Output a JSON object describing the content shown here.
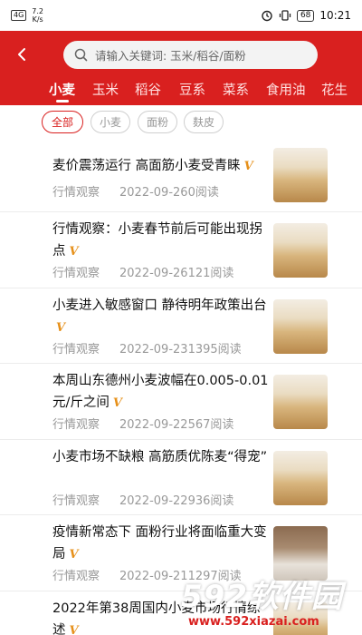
{
  "status_bar": {
    "signal": "4G",
    "speed": "7.2",
    "speed_unit": "K/s",
    "battery": "68",
    "time": "10:21"
  },
  "header": {
    "search_placeholder": "请输入关键词: 玉米/稻谷/面粉",
    "tabs": [
      {
        "label": "小麦",
        "active": true
      },
      {
        "label": "玉米",
        "active": false
      },
      {
        "label": "稻谷",
        "active": false
      },
      {
        "label": "豆系",
        "active": false
      },
      {
        "label": "菜系",
        "active": false
      },
      {
        "label": "食用油",
        "active": false
      },
      {
        "label": "花生",
        "active": false
      }
    ],
    "accent_color": "#d9201f"
  },
  "filters": [
    {
      "label": "全部",
      "active": true
    },
    {
      "label": "小麦",
      "active": false
    },
    {
      "label": "面粉",
      "active": false
    },
    {
      "label": "麸皮",
      "active": false
    }
  ],
  "articles": [
    {
      "title": "麦价震荡运行 高面筋小麦受青睐",
      "v": "V",
      "source": "行情观察",
      "date": "2022-09-26",
      "reads": "0阅读",
      "image": "wheat-field"
    },
    {
      "title": "行情观察：小麦春节前后可能出现拐点",
      "v": "V",
      "source": "行情观察",
      "date": "2022-09-26",
      "reads": "121阅读",
      "image": "wheat-field"
    },
    {
      "title": "小麦进入敏感窗口 静待明年政策出台",
      "v": "V",
      "source": "行情观察",
      "date": "2022-09-23",
      "reads": "1395阅读",
      "image": "wheat-field"
    },
    {
      "title": "本周山东德州小麦波幅在0.005-0.01元/斤之间",
      "v": "V",
      "source": "行情观察",
      "date": "2022-09-22",
      "reads": "567阅读",
      "image": "wheat-field"
    },
    {
      "title": "小麦市场不缺粮 高筋质优陈麦“得宠”",
      "v": "",
      "source": "行情观察",
      "date": "2022-09-22",
      "reads": "936阅读",
      "image": "wheat-field"
    },
    {
      "title": "疫情新常态下 面粉行业将面临重大变局",
      "v": "V",
      "source": "行情观察",
      "date": "2022-09-21",
      "reads": "1297阅读",
      "image": "flour"
    },
    {
      "title": "2022年第38周国内小麦市场行情综述",
      "v": "V",
      "source": "",
      "date": "",
      "reads": "",
      "image": "wheat-field"
    }
  ],
  "watermark": {
    "brand": "592软件园",
    "url": "www.592xiazai.com"
  }
}
